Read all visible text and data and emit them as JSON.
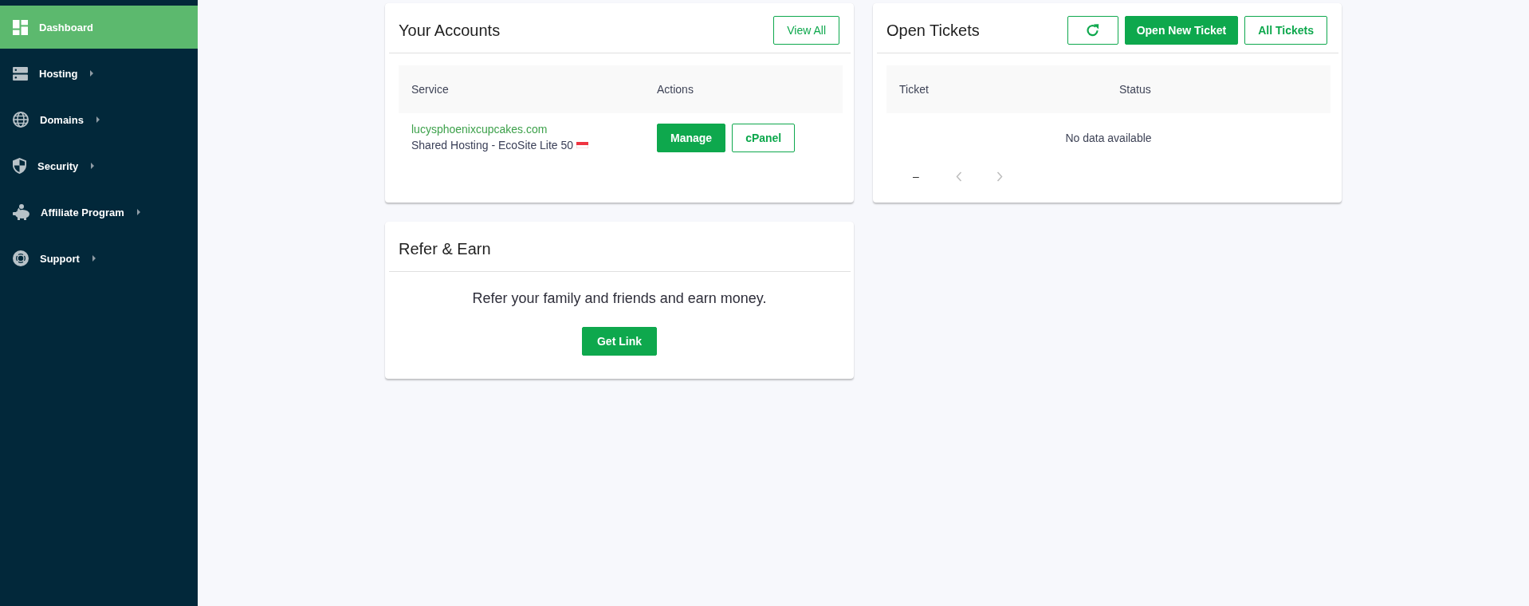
{
  "sidebar": {
    "items": [
      {
        "label": "Dashboard",
        "selected": true,
        "has_submenu": false
      },
      {
        "label": "Hosting",
        "selected": false,
        "has_submenu": true
      },
      {
        "label": "Domains",
        "selected": false,
        "has_submenu": true
      },
      {
        "label": "Security",
        "selected": false,
        "has_submenu": true
      },
      {
        "label": "Affiliate Program",
        "selected": false,
        "has_submenu": true
      },
      {
        "label": "Support",
        "selected": false,
        "has_submenu": true
      }
    ]
  },
  "accounts": {
    "title": "Your Accounts",
    "view_all_button": "View All",
    "columns": [
      "Service",
      "Actions"
    ],
    "rows": [
      {
        "domain": "lucysphoenixcupcakes.com",
        "plan": "Shared Hosting - EcoSite Lite 50",
        "actions": [
          {
            "label": "Manage",
            "kind": "primary"
          },
          {
            "label": "cPanel",
            "kind": "outline"
          }
        ]
      }
    ]
  },
  "tickets": {
    "title": "Open Tickets",
    "buttons": [
      {
        "label": "Open New Ticket",
        "kind": "primary"
      },
      {
        "label": "All Tickets",
        "kind": "outline"
      }
    ],
    "columns": [
      "Ticket",
      "Status"
    ],
    "empty_message": "No data available",
    "pagination": {
      "range": "–",
      "prev_disabled": true,
      "next_disabled": true
    }
  },
  "refer": {
    "title": "Refer & Earn",
    "message": "Refer your family and friends and earn money.",
    "button": "Get Link"
  }
}
